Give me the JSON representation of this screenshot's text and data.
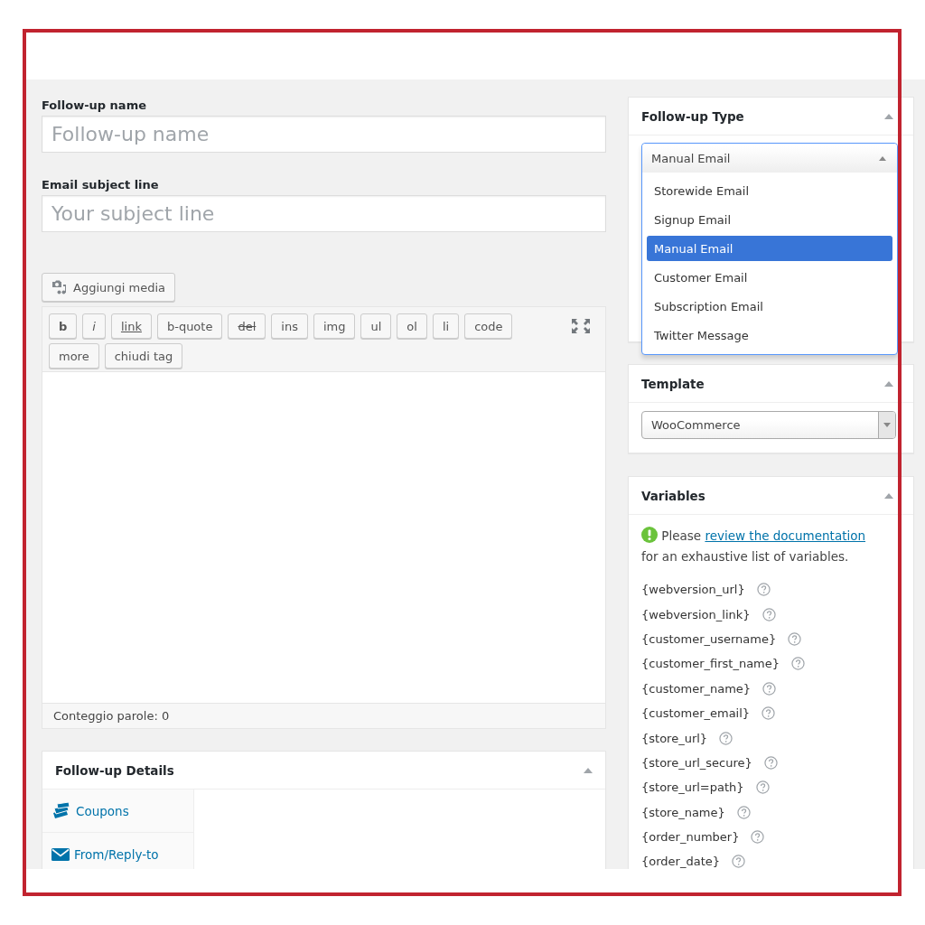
{
  "form": {
    "fields": [
      {
        "label": "Follow-up name",
        "placeholder": "Follow-up name"
      },
      {
        "label": "Email subject line",
        "placeholder": "Your subject line"
      }
    ]
  },
  "editor": {
    "media_button": "Aggiungi media",
    "toolbar": [
      {
        "label": "b",
        "kind": "bold"
      },
      {
        "label": "i",
        "kind": "italic"
      },
      {
        "label": "link",
        "kind": "underline"
      },
      {
        "label": "b-quote",
        "kind": "plain"
      },
      {
        "label": "del",
        "kind": "strike"
      },
      {
        "label": "ins",
        "kind": "plain"
      },
      {
        "label": "img",
        "kind": "plain"
      },
      {
        "label": "ul",
        "kind": "plain"
      },
      {
        "label": "ol",
        "kind": "plain"
      },
      {
        "label": "li",
        "kind": "plain"
      },
      {
        "label": "code",
        "kind": "plain"
      },
      {
        "label": "more",
        "kind": "plain"
      },
      {
        "label": "chiudi tag",
        "kind": "plain"
      }
    ],
    "word_count": "Conteggio parole: 0"
  },
  "details": {
    "title": "Follow-up Details",
    "tabs": [
      {
        "label": "Coupons",
        "kind": "coupons"
      },
      {
        "label": "From/Reply-to",
        "kind": "mail"
      }
    ]
  },
  "follow_up_type": {
    "title": "Follow-up Type",
    "value": "Manual Email",
    "expanded": true,
    "options": [
      {
        "label": "Storewide Email",
        "selected": false
      },
      {
        "label": "Signup Email",
        "selected": false
      },
      {
        "label": "Manual Email",
        "selected": true
      },
      {
        "label": "Customer Email",
        "selected": false
      },
      {
        "label": "Subscription Email",
        "selected": false
      },
      {
        "label": "Twitter Message",
        "selected": false
      }
    ]
  },
  "template": {
    "title": "Template",
    "value": "WooCommerce"
  },
  "variables": {
    "title": "Variables",
    "notice": {
      "before": "Please",
      "link": "review the documentation",
      "after": "for an exhaustive list of variables."
    },
    "items": [
      "{webversion_url}",
      "{webversion_link}",
      "{customer_username}",
      "{customer_first_name}",
      "{customer_name}",
      "{customer_email}",
      "{store_url}",
      "{store_url_secure}",
      "{store_url=path}",
      "{store_name}",
      "{order_number}",
      "{order_date}"
    ]
  }
}
